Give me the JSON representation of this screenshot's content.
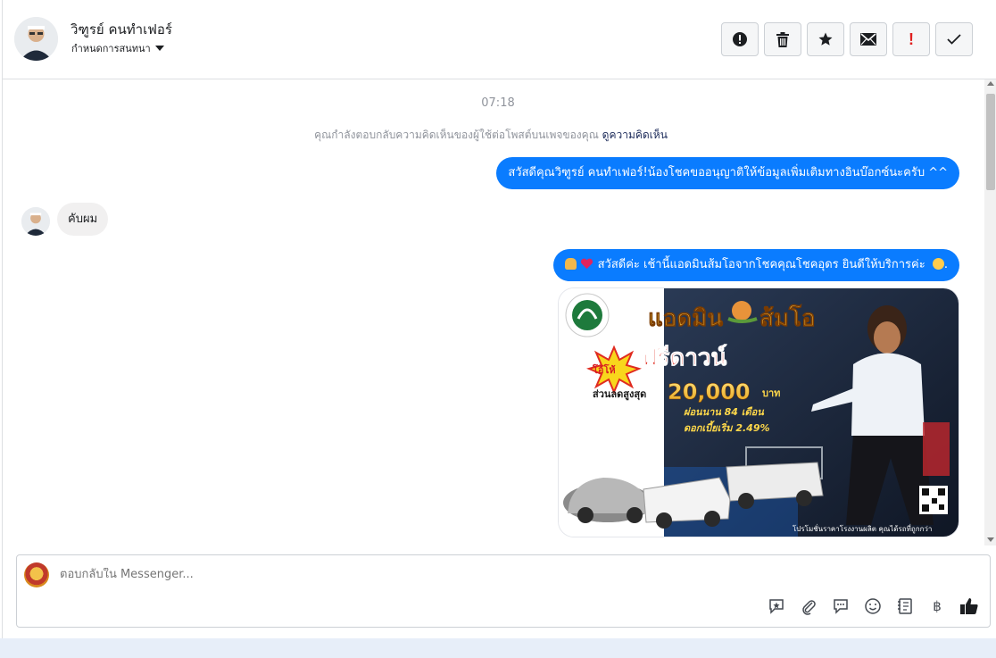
{
  "header": {
    "contact_name": "วิฑูรย์ คนทำเฟอร์",
    "assign_label": "กำหนดการสนทนา",
    "actions": [
      {
        "name": "spam-button",
        "icon": "alert-circle-icon"
      },
      {
        "name": "delete-button",
        "icon": "trash-icon"
      },
      {
        "name": "star-button",
        "icon": "star-icon"
      },
      {
        "name": "mark-unread-button",
        "icon": "envelope-icon"
      },
      {
        "name": "follow-up-button",
        "icon": "exclamation-icon",
        "text": "!"
      },
      {
        "name": "done-button",
        "icon": "check-icon"
      }
    ]
  },
  "conversation": {
    "timestamp": "07:18",
    "notice_text": "คุณกำลังตอบกลับความคิดเห็นของผู้ใช้ต่อโพสต์บนเพจของคุณ",
    "notice_link": "ดูความคิดเห็น",
    "messages": [
      {
        "direction": "outgoing",
        "text": "สวัสดีคุณวิฑูรย์ คนทำเฟอร์!น้องโชคขออนุญาติให้ข้อมูลเพิ่มเติมทางอินบ๊อกซ์นะครับ ^^"
      },
      {
        "direction": "incoming",
        "text": "คับผม"
      },
      {
        "direction": "outgoing",
        "text": "สวัสดีค่ะ เช้านี้แอดมินส้มโอจากโชคคุณโชคอุดร ยินดีให้บริการค่ะ",
        "suffix": "."
      }
    ],
    "promo_image": {
      "headline": "แอดมิน",
      "headline2": "ส้มโอ",
      "badge": "โอ้โห้",
      "free_down": "ฟรีดาวน์",
      "discount_label": "ส่วนลดสูงสุด",
      "discount_value": "20,000",
      "discount_unit": "บาท",
      "installment": "ผ่อนนาน 84 เดือน",
      "interest": "ดอกเบี้ยเริ่ม 2.49%",
      "footer": "โปรโมชั่นราคาโรงงานผลิต คุณได้รถที่ถูกกว่า"
    }
  },
  "composer": {
    "placeholder": "ตอบกลับใน Messenger...",
    "icons": [
      "saved-reply-icon",
      "attachment-icon",
      "chat-bubble-icon",
      "emoji-icon",
      "notes-icon",
      "baht-payment-icon",
      "like-icon"
    ],
    "baht_symbol": "฿"
  },
  "colors": {
    "outgoing_bubble": "#0a7cff",
    "incoming_bubble": "#f1f0f0",
    "link": "#1c2b5a"
  }
}
